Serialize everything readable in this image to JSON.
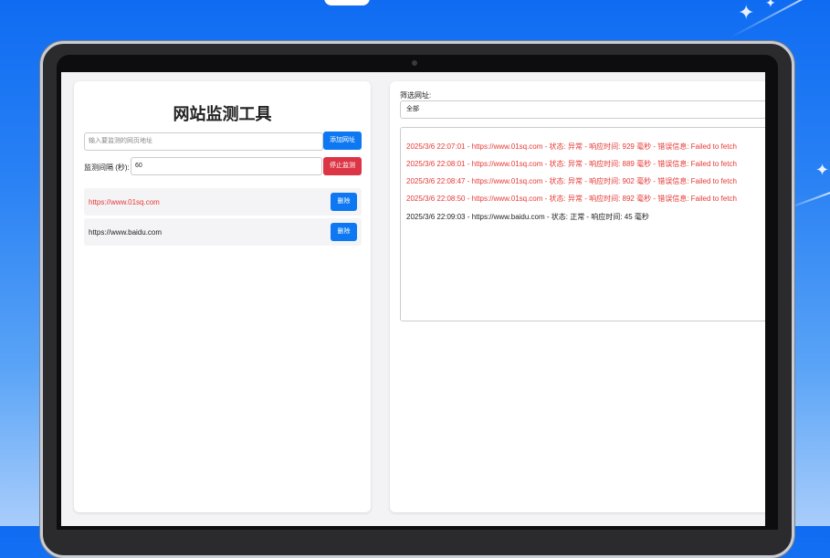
{
  "app": {
    "title": "网站监测工具",
    "url_input_placeholder": "输入要监测的网页地址",
    "add_button": "添加网址",
    "interval_label": "监测间隔 (秒):",
    "interval_value": "60",
    "stop_button": "停止监测"
  },
  "sites": [
    {
      "url": "https://www.01sq.com",
      "status": "error",
      "delete_label": "删除"
    },
    {
      "url": "https://www.baidu.com",
      "status": "ok",
      "delete_label": "删除"
    }
  ],
  "filter": {
    "label": "筛选网址:",
    "selected": "全部"
  },
  "logs": [
    {
      "text": "2025/3/6 22:07:01 - https://www.01sq.com - 状态: 异常 - 响应时间: 929 毫秒 - 错误信息: Failed to fetch",
      "status": "error"
    },
    {
      "text": "2025/3/6 22:08:01 - https://www.01sq.com - 状态: 异常 - 响应时间: 889 毫秒 - 错误信息: Failed to fetch",
      "status": "error"
    },
    {
      "text": "2025/3/6 22:08:47 - https://www.01sq.com - 状态: 异常 - 响应时间: 902 毫秒 - 错误信息: Failed to fetch",
      "status": "error"
    },
    {
      "text": "2025/3/6 22:08:50 - https://www.01sq.com - 状态: 异常 - 响应时间: 892 毫秒 - 错误信息: Failed to fetch",
      "status": "error"
    },
    {
      "text": "2025/3/6 22:09:03 - https://www.baidu.com - 状态: 正常 - 响应时间: 45 毫秒",
      "status": "ok"
    }
  ],
  "colors": {
    "error_text": "#e53935",
    "ok_text": "#222222",
    "primary_button": "#0d78f2",
    "danger_button": "#dc3545"
  }
}
